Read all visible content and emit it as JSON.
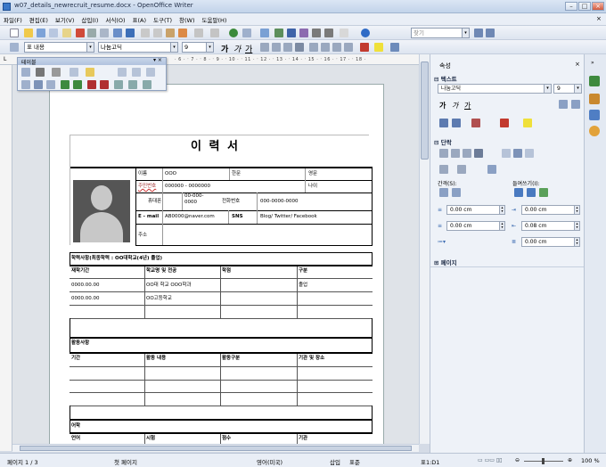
{
  "window": {
    "title": "w07_details_newrecruit_resume.docx - OpenOffice Writer"
  },
  "menu": [
    "파일(F)",
    "편집(E)",
    "보기(V)",
    "삽입(I)",
    "서식(O)",
    "표(A)",
    "도구(T)",
    "창(W)",
    "도움말(H)"
  ],
  "formatting": {
    "style": "표 내용",
    "font": "나눔고딕",
    "size": "9",
    "find_placeholder": "찾기"
  },
  "float_toolbar": {
    "title": "테이블"
  },
  "sidebar": {
    "title": "속성",
    "text_section": "텍스트",
    "font": "나눔고딕",
    "size": "9",
    "paragraph_section": "단락",
    "spacing_label": "간격(S):",
    "indent_label": "들여쓰기(I):",
    "spacing_above": "0.00 cm",
    "spacing_below": "0.00 cm",
    "indent_before": "0.00 cm",
    "indent_after": "0.08 cm",
    "indent_first": "0.00 cm",
    "page_section": "페이지"
  },
  "status": {
    "page": "페이지 1 / 3",
    "style": "첫 페이지",
    "lang": "영어(미국)",
    "mode_insert": "삽입",
    "mode_std": "표준",
    "cell": "표1:D1",
    "zoom": "100 %"
  },
  "resume": {
    "title": "이 력 서",
    "name_label": "이름",
    "name_value": "OOO",
    "hanja_label": "한문",
    "english_label": "영문",
    "rrn_label": "주민번호",
    "rrn_value": "000000 - 0000000",
    "age_label": "나이",
    "mobile_label": "휴대폰",
    "mobile_value": "00-000-0000",
    "phone_label": "전화번호",
    "phone_value": "000-0000-0000",
    "email_label": "E - mail",
    "email_value": "AB0000@naver.com",
    "sns_label": "SNS",
    "sns_value": "Blog/ Twitter/ Facebook",
    "address_label": "주소",
    "edu_header": "학력사항(최종학력 : OO대학교(4년) 졸업)",
    "edu_cols": [
      "재학기간",
      "학교명 및 전공",
      "학점",
      "구분"
    ],
    "edu_rows": [
      [
        "0000.00.00",
        "OO대 학교 OOO학과",
        "",
        "졸업"
      ],
      [
        "0000.00.00",
        "OO고등학교",
        "",
        ""
      ]
    ],
    "act_header": "활동사항",
    "act_cols": [
      "기간",
      "활동 내용",
      "활동구분",
      "기관 및 장소"
    ],
    "lang_header": "어학",
    "lang_cols": [
      "언어",
      "시험",
      "점수",
      "기관"
    ]
  }
}
